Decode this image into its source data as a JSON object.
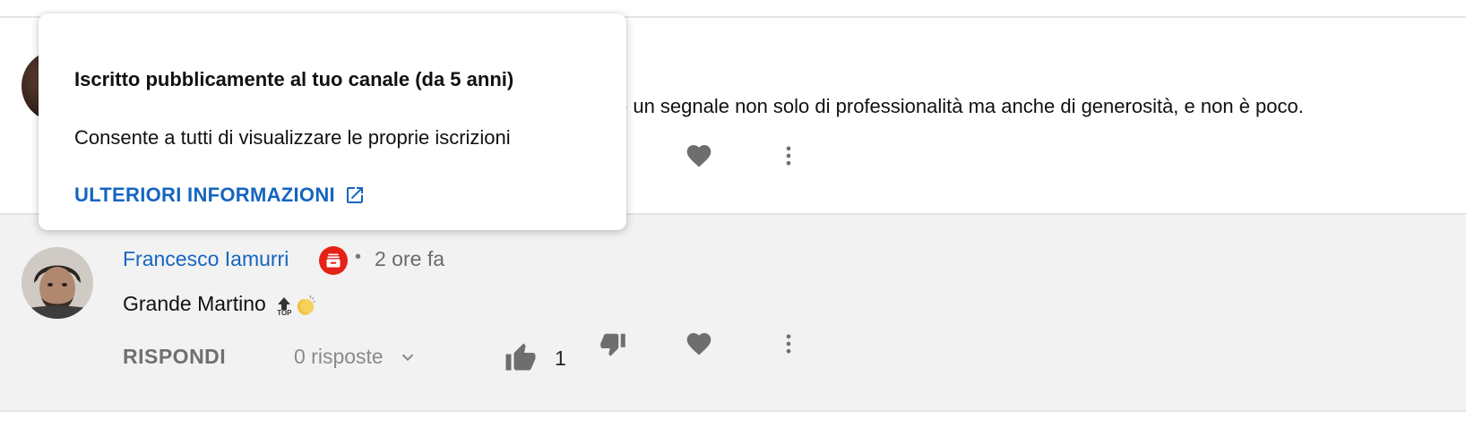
{
  "top_comment": {
    "text_fragment": "è un segnale non solo di professionalità ma anche di generosità, e non è poco."
  },
  "comment": {
    "author": "Francesco Iamurri",
    "separator": "•",
    "time": "2 ore fa",
    "body": "Grande Martino",
    "emoji_top_label": "TOP",
    "reply_label": "RISPONDI",
    "replies_label": "0 risposte",
    "like_count": "1"
  },
  "popup": {
    "title": "Iscritto pubblicamente al tuo canale (da 5 anni)",
    "description": "Consente a tutti di visualizzare le proprie iscrizioni",
    "link_label": "ULTERIORI INFORMAZIONI"
  },
  "colors": {
    "link_blue": "#1565c0",
    "badge_red": "#e62117",
    "highlight_bg": "#f2f2f2"
  },
  "icons": [
    "thumb-up-icon",
    "thumb-down-icon",
    "heart-icon",
    "more-vert-icon",
    "chevron-down-icon",
    "external-link-icon",
    "subscription-badge-icon"
  ]
}
